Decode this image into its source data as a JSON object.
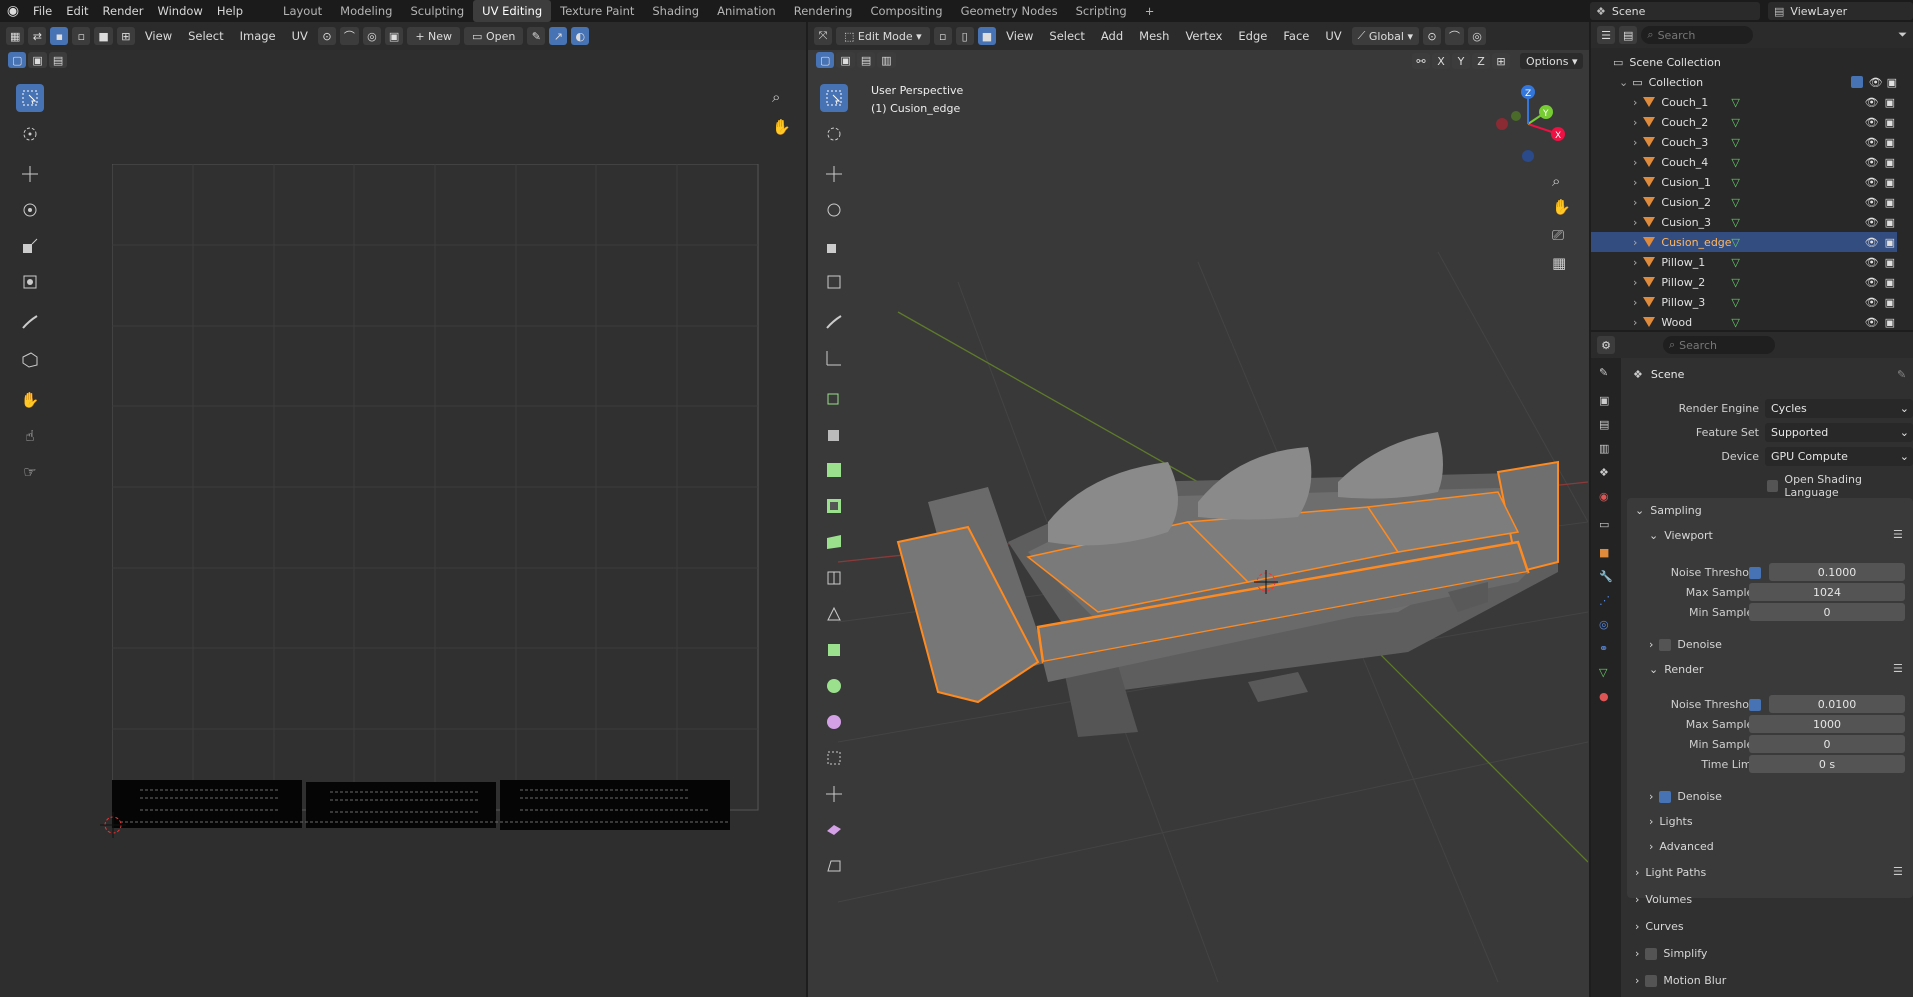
{
  "topbar": {
    "menus": [
      "File",
      "Edit",
      "Render",
      "Window",
      "Help"
    ],
    "workspaces": [
      "Layout",
      "Modeling",
      "Sculpting",
      "UV Editing",
      "Texture Paint",
      "Shading",
      "Animation",
      "Rendering",
      "Compositing",
      "Geometry Nodes",
      "Scripting"
    ],
    "active_workspace": "UV Editing",
    "add_tab": "+",
    "scene_name": "Scene",
    "viewlayer_name": "ViewLayer"
  },
  "uv_editor": {
    "menus": [
      "View",
      "Select",
      "Image",
      "UV"
    ],
    "new_label": "New",
    "open_label": "Open"
  },
  "viewport": {
    "mode": "Edit Mode",
    "menus": [
      "View",
      "Select",
      "Add",
      "Mesh",
      "Vertex",
      "Edge",
      "Face",
      "UV"
    ],
    "transform": "Global",
    "axes": [
      "X",
      "Y",
      "Z"
    ],
    "options_label": "Options",
    "overlay_title": "User Perspective",
    "overlay_object": "(1) Cusion_edge",
    "gizmo": {
      "x": "X",
      "y": "Y",
      "z": "Z"
    }
  },
  "outliner": {
    "search_placeholder": "Search",
    "root": "Scene Collection",
    "collection": "Collection",
    "items": [
      {
        "name": "Couch_1",
        "selected": false
      },
      {
        "name": "Couch_2",
        "selected": false
      },
      {
        "name": "Couch_3",
        "selected": false
      },
      {
        "name": "Couch_4",
        "selected": false
      },
      {
        "name": "Cusion_1",
        "selected": false
      },
      {
        "name": "Cusion_2",
        "selected": false
      },
      {
        "name": "Cusion_3",
        "selected": false
      },
      {
        "name": "Cusion_edge",
        "selected": true
      },
      {
        "name": "Pillow_1",
        "selected": false
      },
      {
        "name": "Pillow_2",
        "selected": false
      },
      {
        "name": "Pillow_3",
        "selected": false
      },
      {
        "name": "Wood",
        "selected": false
      }
    ]
  },
  "properties": {
    "search_placeholder": "Search",
    "context": "Scene",
    "render_engine_label": "Render Engine",
    "render_engine": "Cycles",
    "feature_set_label": "Feature Set",
    "feature_set": "Supported",
    "device_label": "Device",
    "device": "GPU Compute",
    "osl_label": "Open Shading Language",
    "sampling": "Sampling",
    "viewport": "Viewport",
    "noise_threshold_label": "Noise Threshold",
    "vp_noise_threshold": "0.1000",
    "max_samples_label": "Max Samples",
    "vp_max_samples": "1024",
    "min_samples_label": "Min Samples",
    "vp_min_samples": "0",
    "denoise_label": "Denoise",
    "render": "Render",
    "r_noise_threshold": "0.0100",
    "r_max_samples": "1000",
    "r_min_samples": "0",
    "time_limit_label": "Time Limit",
    "time_limit": "0 s",
    "lights": "Lights",
    "advanced": "Advanced",
    "light_paths": "Light Paths",
    "volumes": "Volumes",
    "curves": "Curves",
    "simplify": "Simplify",
    "motion_blur": "Motion Blur"
  },
  "colors": {
    "accent": "#4772b3",
    "selection": "#ff8a1f",
    "panel_bg": "#303030",
    "viewport_bg": "#3a3a3a"
  }
}
